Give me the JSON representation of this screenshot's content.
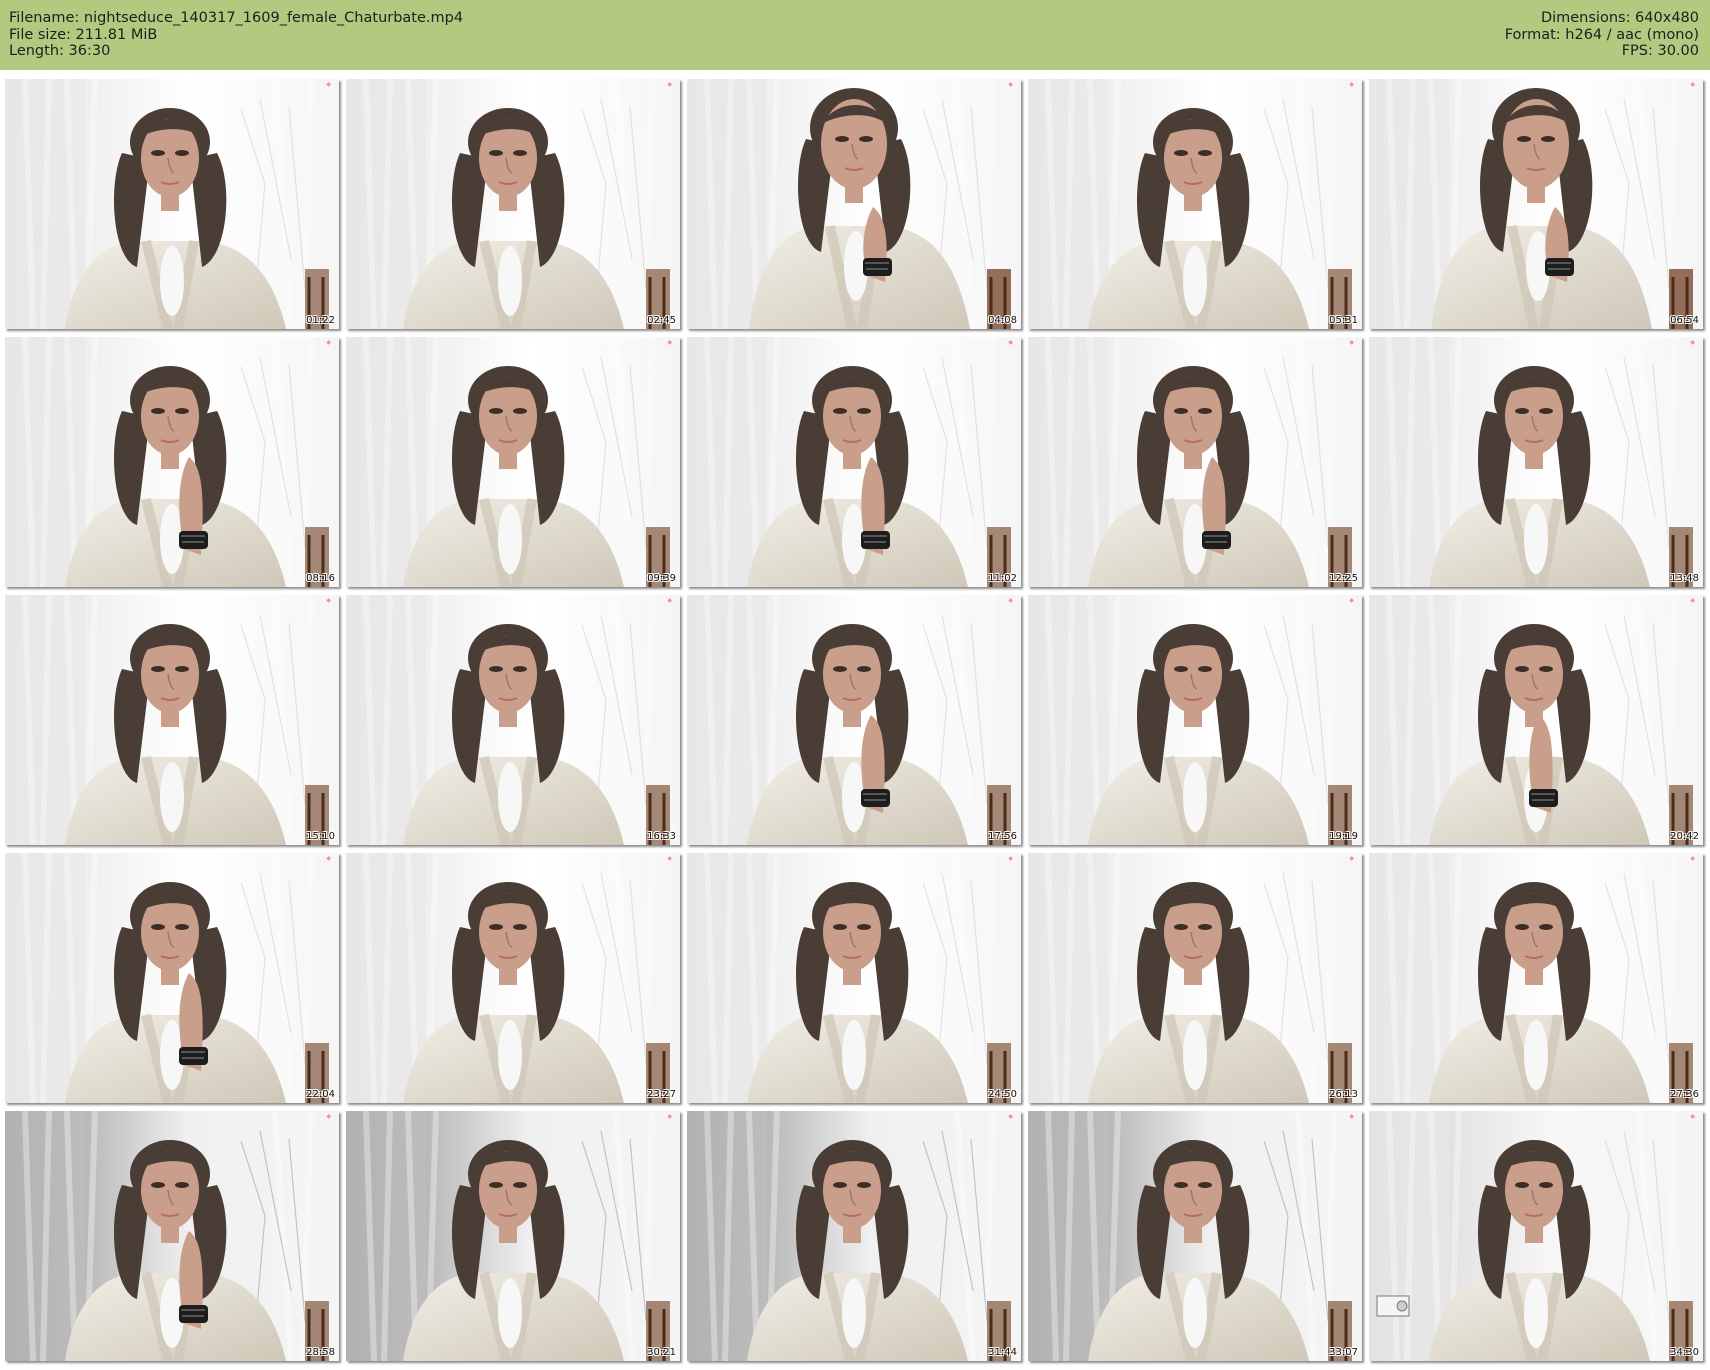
{
  "header": {
    "filename": "Filename: nightseduce_140317_1609_female_Chaturbate.mp4",
    "filesize": "File size: 211.81 MiB",
    "length": "Length: 36:30",
    "dimensions": "Dimensions: 640x480",
    "format": "Format: h264 / aac (mono)",
    "fps": "FPS: 30.00",
    "background_color": "#b1ca80"
  },
  "thumbnails": [
    {
      "timestamp": "01:22"
    },
    {
      "timestamp": "02:45"
    },
    {
      "timestamp": "04:08"
    },
    {
      "timestamp": "05:31"
    },
    {
      "timestamp": "06:54"
    },
    {
      "timestamp": "08:16"
    },
    {
      "timestamp": "09:39"
    },
    {
      "timestamp": "11:02"
    },
    {
      "timestamp": "12:25"
    },
    {
      "timestamp": "13:48"
    },
    {
      "timestamp": "15:10"
    },
    {
      "timestamp": "16:33"
    },
    {
      "timestamp": "17:56"
    },
    {
      "timestamp": "19:19"
    },
    {
      "timestamp": "20:42"
    },
    {
      "timestamp": "22:04"
    },
    {
      "timestamp": "23:27"
    },
    {
      "timestamp": "24:50"
    },
    {
      "timestamp": "26:13"
    },
    {
      "timestamp": "27:36"
    },
    {
      "timestamp": "28:58"
    },
    {
      "timestamp": "30:21"
    },
    {
      "timestamp": "31:44"
    },
    {
      "timestamp": "33:07"
    },
    {
      "timestamp": "34:30"
    }
  ]
}
